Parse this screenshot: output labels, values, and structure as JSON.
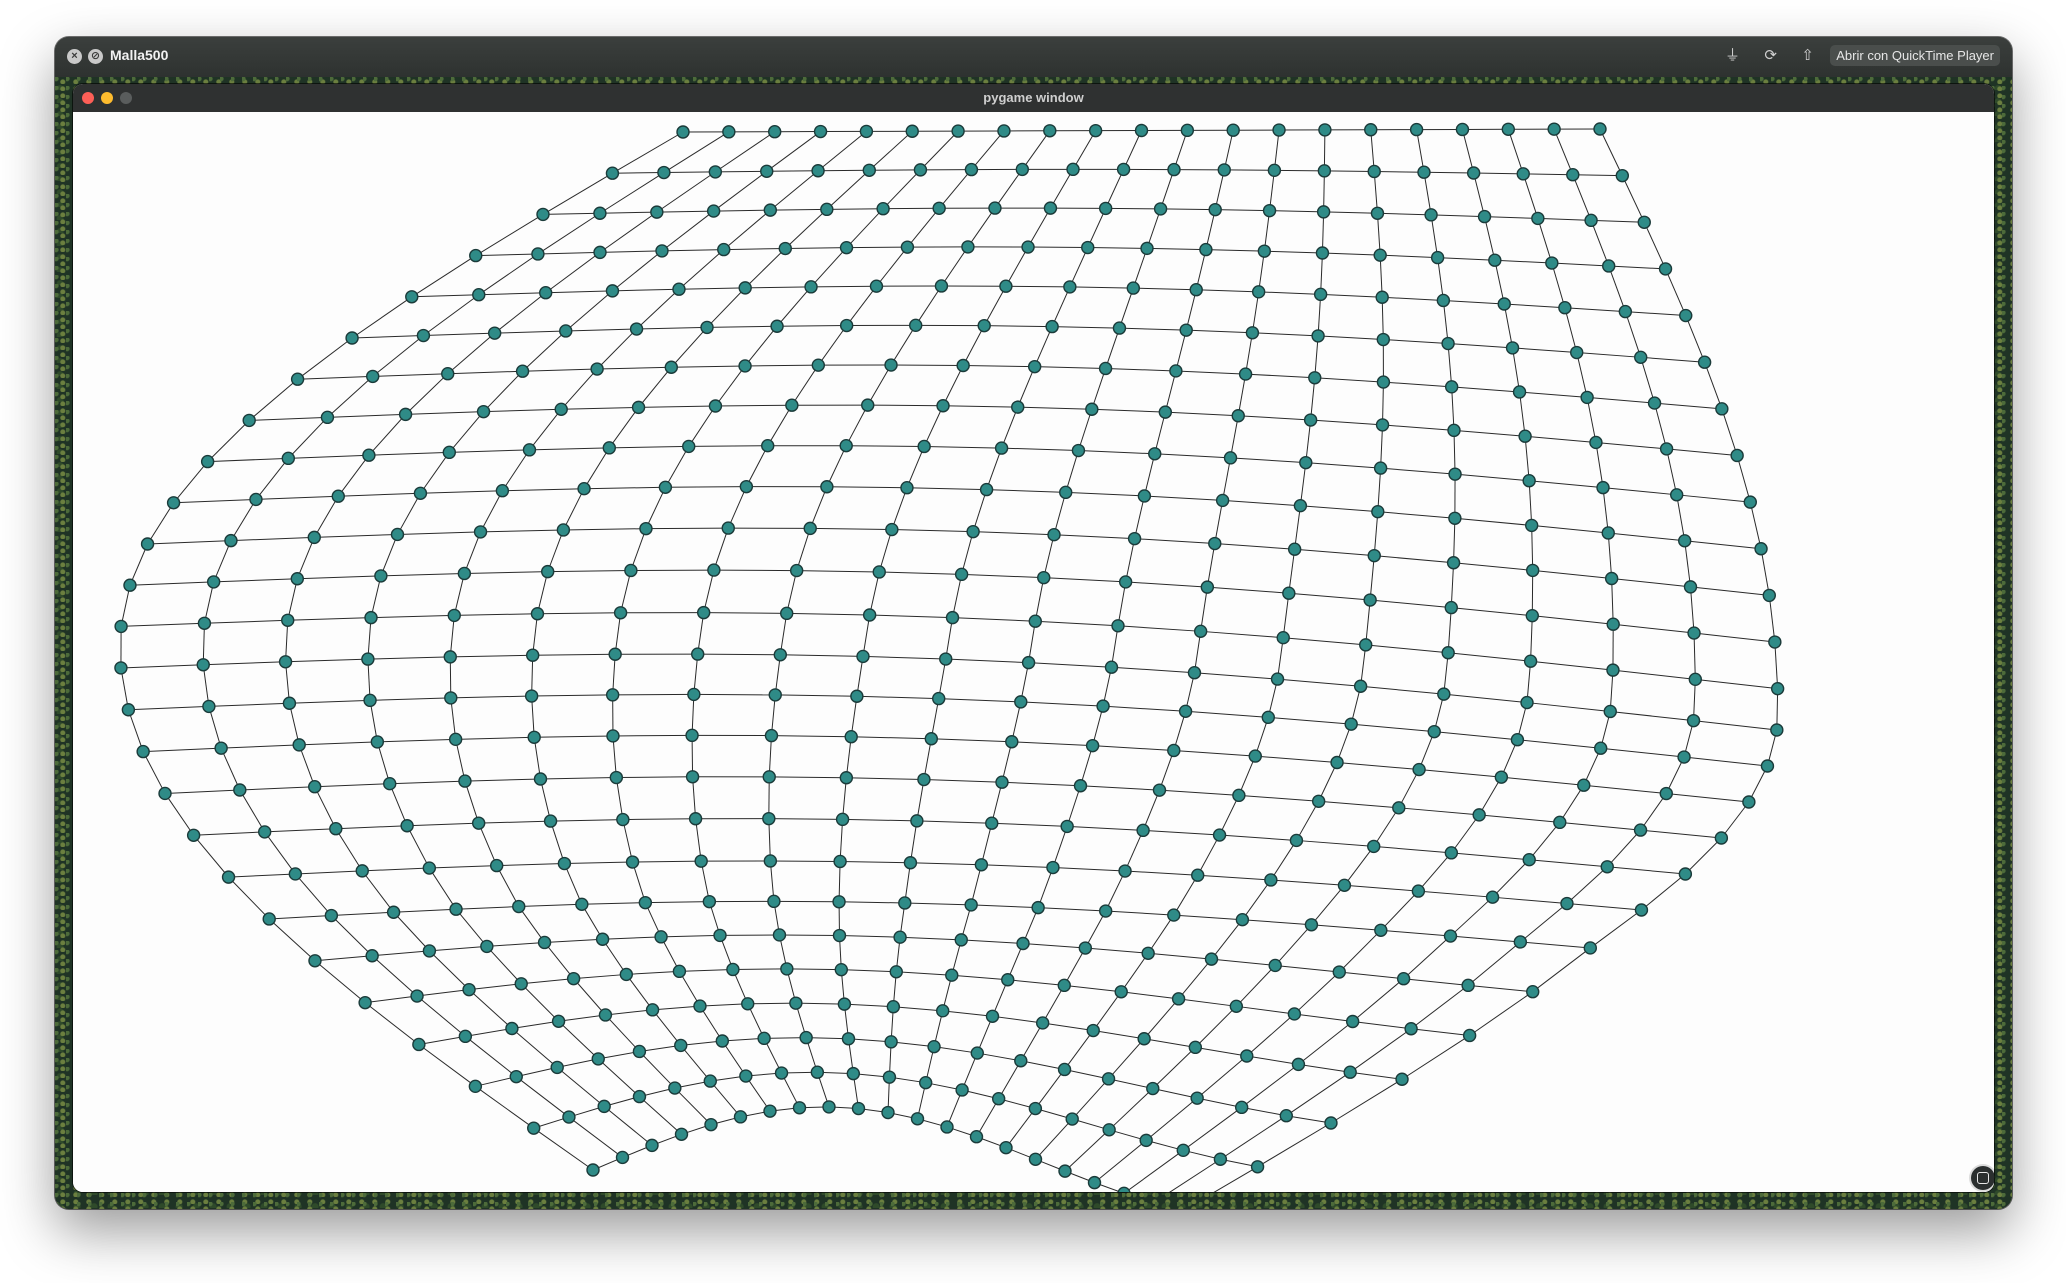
{
  "quicktime": {
    "title": "Malla500",
    "open_with": "Abrir con QuickTime Player",
    "close_glyph": "×",
    "other_glyph": "⊘",
    "trim_glyph": "⏚",
    "rotate_glyph": "⟳",
    "share_glyph": "⇧"
  },
  "pygame": {
    "title": "pygame window"
  },
  "mesh": {
    "rows": 26,
    "columns": 21,
    "node_color": "#2f8b87",
    "edge_color": "#2a2a2a",
    "background": "#fdfdfd"
  }
}
